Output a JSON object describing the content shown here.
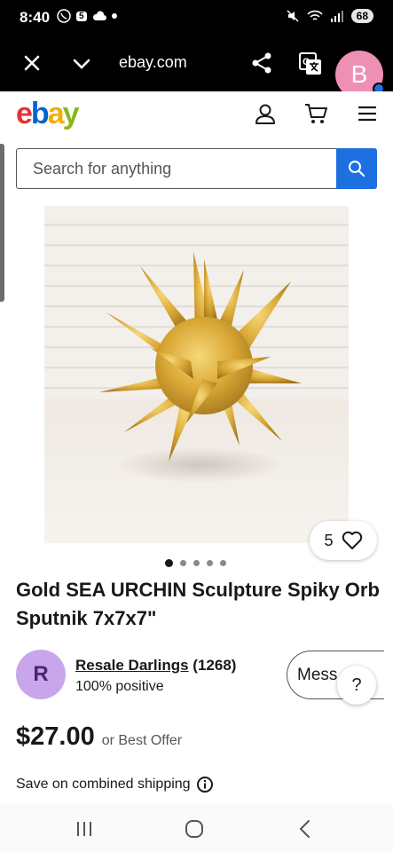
{
  "status_bar": {
    "time": "8:40",
    "battery": "68",
    "notification_badge": "5"
  },
  "browser": {
    "url": "ebay.com",
    "avatar_letter": "B"
  },
  "header": {
    "logo": {
      "e": "e",
      "b": "b",
      "a": "a",
      "y": "y"
    }
  },
  "search": {
    "placeholder": "Search for anything"
  },
  "product": {
    "watch_count": "5",
    "image_count": 5,
    "active_image": 1,
    "title": "Gold SEA URCHIN Sculpture Spiky Orb Sputnik 7x7x7\"",
    "price": "$27.00",
    "best_offer": "or Best Offer",
    "shipping": "Save on combined shipping"
  },
  "seller": {
    "initial": "R",
    "name": "Resale Darlings",
    "feedback": "(1268)",
    "positive": "100% positive",
    "message_label": "Mess",
    "help_label": "?"
  },
  "colors": {
    "accent": "#1e6fe0",
    "avatar_browser": "#ee8fb4",
    "avatar_seller": "#c9a6ec",
    "gold": "#d9a836"
  }
}
